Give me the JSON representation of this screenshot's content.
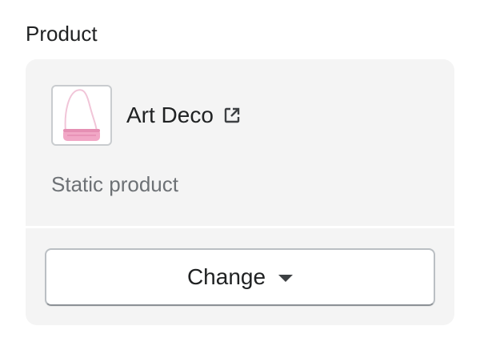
{
  "section": {
    "label": "Product"
  },
  "product": {
    "name": "Art Deco",
    "subtitle": "Static product",
    "thumbnail_icon": "pink-handbag-image",
    "external_link_icon": "external-link-icon",
    "thumbnail_color": "#f1a7c6"
  },
  "actions": {
    "change_label": "Change",
    "change_icon": "caret-down-icon"
  }
}
